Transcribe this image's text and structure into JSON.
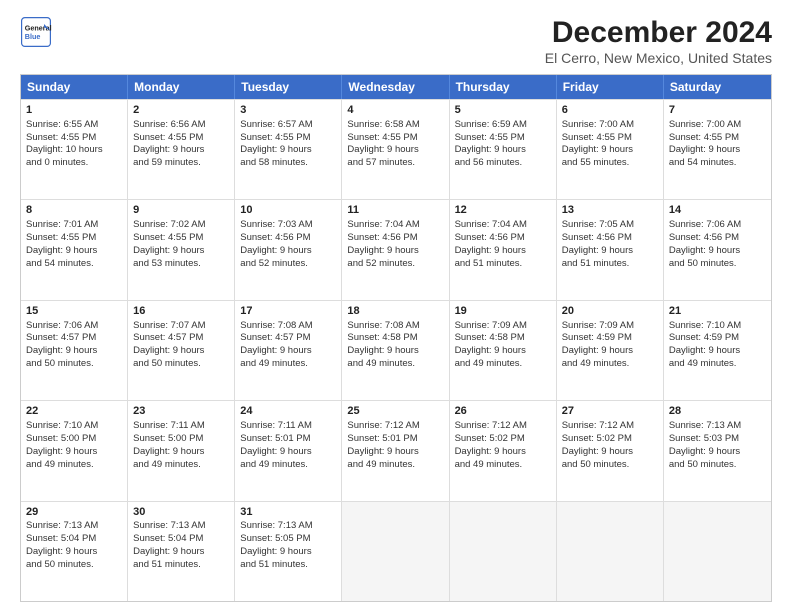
{
  "logo": {
    "line1": "General",
    "line2": "Blue"
  },
  "title": "December 2024",
  "subtitle": "El Cerro, New Mexico, United States",
  "header_days": [
    "Sunday",
    "Monday",
    "Tuesday",
    "Wednesday",
    "Thursday",
    "Friday",
    "Saturday"
  ],
  "rows": [
    [
      {
        "day": "1",
        "lines": [
          "Sunrise: 6:55 AM",
          "Sunset: 4:55 PM",
          "Daylight: 10 hours",
          "and 0 minutes."
        ]
      },
      {
        "day": "2",
        "lines": [
          "Sunrise: 6:56 AM",
          "Sunset: 4:55 PM",
          "Daylight: 9 hours",
          "and 59 minutes."
        ]
      },
      {
        "day": "3",
        "lines": [
          "Sunrise: 6:57 AM",
          "Sunset: 4:55 PM",
          "Daylight: 9 hours",
          "and 58 minutes."
        ]
      },
      {
        "day": "4",
        "lines": [
          "Sunrise: 6:58 AM",
          "Sunset: 4:55 PM",
          "Daylight: 9 hours",
          "and 57 minutes."
        ]
      },
      {
        "day": "5",
        "lines": [
          "Sunrise: 6:59 AM",
          "Sunset: 4:55 PM",
          "Daylight: 9 hours",
          "and 56 minutes."
        ]
      },
      {
        "day": "6",
        "lines": [
          "Sunrise: 7:00 AM",
          "Sunset: 4:55 PM",
          "Daylight: 9 hours",
          "and 55 minutes."
        ]
      },
      {
        "day": "7",
        "lines": [
          "Sunrise: 7:00 AM",
          "Sunset: 4:55 PM",
          "Daylight: 9 hours",
          "and 54 minutes."
        ]
      }
    ],
    [
      {
        "day": "8",
        "lines": [
          "Sunrise: 7:01 AM",
          "Sunset: 4:55 PM",
          "Daylight: 9 hours",
          "and 54 minutes."
        ]
      },
      {
        "day": "9",
        "lines": [
          "Sunrise: 7:02 AM",
          "Sunset: 4:55 PM",
          "Daylight: 9 hours",
          "and 53 minutes."
        ]
      },
      {
        "day": "10",
        "lines": [
          "Sunrise: 7:03 AM",
          "Sunset: 4:56 PM",
          "Daylight: 9 hours",
          "and 52 minutes."
        ]
      },
      {
        "day": "11",
        "lines": [
          "Sunrise: 7:04 AM",
          "Sunset: 4:56 PM",
          "Daylight: 9 hours",
          "and 52 minutes."
        ]
      },
      {
        "day": "12",
        "lines": [
          "Sunrise: 7:04 AM",
          "Sunset: 4:56 PM",
          "Daylight: 9 hours",
          "and 51 minutes."
        ]
      },
      {
        "day": "13",
        "lines": [
          "Sunrise: 7:05 AM",
          "Sunset: 4:56 PM",
          "Daylight: 9 hours",
          "and 51 minutes."
        ]
      },
      {
        "day": "14",
        "lines": [
          "Sunrise: 7:06 AM",
          "Sunset: 4:56 PM",
          "Daylight: 9 hours",
          "and 50 minutes."
        ]
      }
    ],
    [
      {
        "day": "15",
        "lines": [
          "Sunrise: 7:06 AM",
          "Sunset: 4:57 PM",
          "Daylight: 9 hours",
          "and 50 minutes."
        ]
      },
      {
        "day": "16",
        "lines": [
          "Sunrise: 7:07 AM",
          "Sunset: 4:57 PM",
          "Daylight: 9 hours",
          "and 50 minutes."
        ]
      },
      {
        "day": "17",
        "lines": [
          "Sunrise: 7:08 AM",
          "Sunset: 4:57 PM",
          "Daylight: 9 hours",
          "and 49 minutes."
        ]
      },
      {
        "day": "18",
        "lines": [
          "Sunrise: 7:08 AM",
          "Sunset: 4:58 PM",
          "Daylight: 9 hours",
          "and 49 minutes."
        ]
      },
      {
        "day": "19",
        "lines": [
          "Sunrise: 7:09 AM",
          "Sunset: 4:58 PM",
          "Daylight: 9 hours",
          "and 49 minutes."
        ]
      },
      {
        "day": "20",
        "lines": [
          "Sunrise: 7:09 AM",
          "Sunset: 4:59 PM",
          "Daylight: 9 hours",
          "and 49 minutes."
        ]
      },
      {
        "day": "21",
        "lines": [
          "Sunrise: 7:10 AM",
          "Sunset: 4:59 PM",
          "Daylight: 9 hours",
          "and 49 minutes."
        ]
      }
    ],
    [
      {
        "day": "22",
        "lines": [
          "Sunrise: 7:10 AM",
          "Sunset: 5:00 PM",
          "Daylight: 9 hours",
          "and 49 minutes."
        ]
      },
      {
        "day": "23",
        "lines": [
          "Sunrise: 7:11 AM",
          "Sunset: 5:00 PM",
          "Daylight: 9 hours",
          "and 49 minutes."
        ]
      },
      {
        "day": "24",
        "lines": [
          "Sunrise: 7:11 AM",
          "Sunset: 5:01 PM",
          "Daylight: 9 hours",
          "and 49 minutes."
        ]
      },
      {
        "day": "25",
        "lines": [
          "Sunrise: 7:12 AM",
          "Sunset: 5:01 PM",
          "Daylight: 9 hours",
          "and 49 minutes."
        ]
      },
      {
        "day": "26",
        "lines": [
          "Sunrise: 7:12 AM",
          "Sunset: 5:02 PM",
          "Daylight: 9 hours",
          "and 49 minutes."
        ]
      },
      {
        "day": "27",
        "lines": [
          "Sunrise: 7:12 AM",
          "Sunset: 5:02 PM",
          "Daylight: 9 hours",
          "and 50 minutes."
        ]
      },
      {
        "day": "28",
        "lines": [
          "Sunrise: 7:13 AM",
          "Sunset: 5:03 PM",
          "Daylight: 9 hours",
          "and 50 minutes."
        ]
      }
    ],
    [
      {
        "day": "29",
        "lines": [
          "Sunrise: 7:13 AM",
          "Sunset: 5:04 PM",
          "Daylight: 9 hours",
          "and 50 minutes."
        ]
      },
      {
        "day": "30",
        "lines": [
          "Sunrise: 7:13 AM",
          "Sunset: 5:04 PM",
          "Daylight: 9 hours",
          "and 51 minutes."
        ]
      },
      {
        "day": "31",
        "lines": [
          "Sunrise: 7:13 AM",
          "Sunset: 5:05 PM",
          "Daylight: 9 hours",
          "and 51 minutes."
        ]
      },
      null,
      null,
      null,
      null
    ]
  ]
}
